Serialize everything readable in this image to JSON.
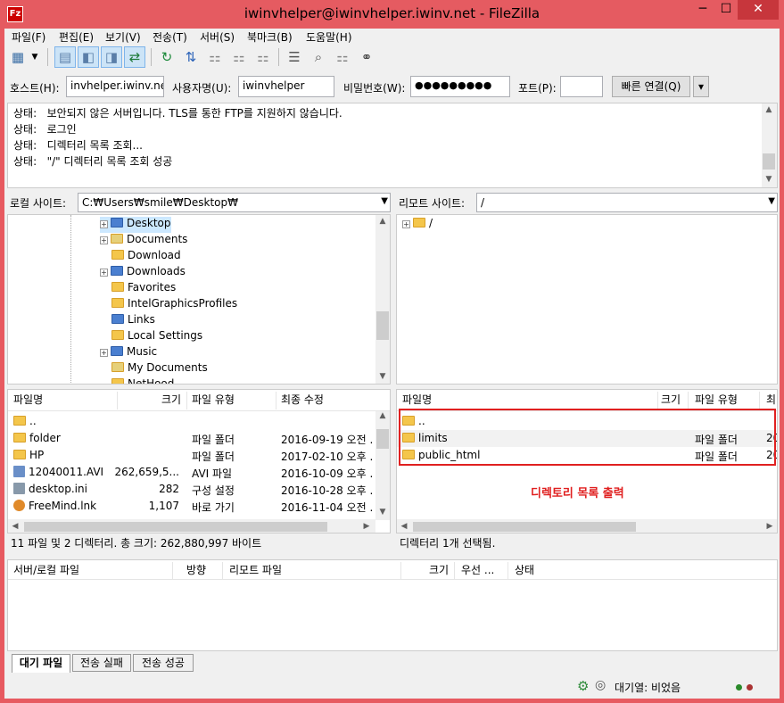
{
  "window": {
    "title": "iwinvhelper@iwinvhelper.iwinv.net - FileZilla",
    "min": "─",
    "max": "☐",
    "close": "✕",
    "app_icon": "Fz"
  },
  "menu": [
    "파일(F)",
    "편집(E)",
    "보기(V)",
    "전송(T)",
    "서버(S)",
    "북마크(B)",
    "도움말(H)"
  ],
  "toolbar_icons": [
    "site-manager-icon",
    "dropdown-icon",
    "toggle-log-icon",
    "toggle-local-tree-icon",
    "toggle-remote-tree-icon",
    "toggle-queue-icon",
    "refresh-icon",
    "process-queue-icon",
    "cancel-icon",
    "disconnect-icon",
    "reconnect-icon",
    "filter-icon",
    "sync-browse-icon",
    "compare-icon",
    "search-icon"
  ],
  "quickconnect": {
    "host_label": "호스트(H):",
    "host_value": "invhelper.iwinv.net",
    "user_label": "사용자명(U):",
    "user_value": "iwinvhelper",
    "pass_label": "비밀번호(W):",
    "pass_value": "●●●●●●●●●",
    "port_label": "포트(P):",
    "port_value": "",
    "connect_button": "빠른 연결(Q)",
    "dropdown": "▾"
  },
  "log": [
    {
      "k": "상태:",
      "v": "보안되지 않은 서버입니다. TLS를 통한 FTP를 지원하지 않습니다."
    },
    {
      "k": "상태:",
      "v": "로그인"
    },
    {
      "k": "상태:",
      "v": "디렉터리 목록 조회..."
    },
    {
      "k": "상태:",
      "v": "\"/\" 디렉터리 목록 조회 성공"
    }
  ],
  "local": {
    "site_label": "로컬 사이트:",
    "path": "C:₩Users₩smile₩Desktop₩",
    "tree": [
      {
        "name": "Desktop",
        "exp": "+",
        "icon": "desktop",
        "sel": true
      },
      {
        "name": "Documents",
        "exp": "+",
        "icon": "doc"
      },
      {
        "name": "Download",
        "exp": "",
        "icon": "folder"
      },
      {
        "name": "Downloads",
        "exp": "+",
        "icon": "blue"
      },
      {
        "name": "Favorites",
        "exp": "",
        "icon": "folder"
      },
      {
        "name": "IntelGraphicsProfiles",
        "exp": "",
        "icon": "folder"
      },
      {
        "name": "Links",
        "exp": "",
        "icon": "blue"
      },
      {
        "name": "Local Settings",
        "exp": "",
        "icon": "folder"
      },
      {
        "name": "Music",
        "exp": "+",
        "icon": "blue"
      },
      {
        "name": "My Documents",
        "exp": "",
        "icon": "doc"
      },
      {
        "name": "NetHood",
        "exp": "",
        "icon": "folder"
      }
    ],
    "headers": [
      "파일명",
      "크기",
      "파일 유형",
      "최종 수정"
    ],
    "rows": [
      {
        "name": "..",
        "size": "",
        "type": "",
        "mod": "",
        "icon": "folder"
      },
      {
        "name": "folder",
        "size": "",
        "type": "파일 폴더",
        "mod": "2016-09-19 오전 ...",
        "icon": "folder"
      },
      {
        "name": "HP",
        "size": "",
        "type": "파일 폴더",
        "mod": "2017-02-10 오후 ...",
        "icon": "folder"
      },
      {
        "name": "12040011.AVI",
        "size": "262,659,5...",
        "type": "AVI 파일",
        "mod": "2016-10-09 오후 ...",
        "icon": "avi"
      },
      {
        "name": "desktop.ini",
        "size": "282",
        "type": "구성 설정",
        "mod": "2016-10-28 오후 ...",
        "icon": "ini"
      },
      {
        "name": "FreeMind.lnk",
        "size": "1,107",
        "type": "바로 가기",
        "mod": "2016-11-04 오전 ...",
        "icon": "butterfly"
      }
    ],
    "status": "11 파일 및 2 디렉터리. 총 크기: 262,880,997 바이트"
  },
  "remote": {
    "site_label": "리모트 사이트:",
    "path": "/",
    "tree": [
      {
        "name": "/",
        "exp": "+"
      }
    ],
    "headers": [
      "파일명",
      "크기",
      "파일 유형",
      "최"
    ],
    "rows": [
      {
        "name": "..",
        "type": ""
      },
      {
        "name": "limits",
        "type": "파일 폴더",
        "extra": "20"
      },
      {
        "name": "public_html",
        "type": "파일 폴더",
        "extra": "20"
      }
    ],
    "annotation": "디렉토리 목록 출력",
    "status": "디렉터리 1개 선택됨."
  },
  "queue": {
    "headers": [
      "서버/로컬 파일",
      "방향",
      "리모트 파일",
      "크기",
      "우선 ...",
      "상태"
    ],
    "tabs": [
      "대기 파일",
      "전송 실패",
      "전송 성공"
    ]
  },
  "bottom": {
    "queue_status": "대기열: 비었음"
  }
}
